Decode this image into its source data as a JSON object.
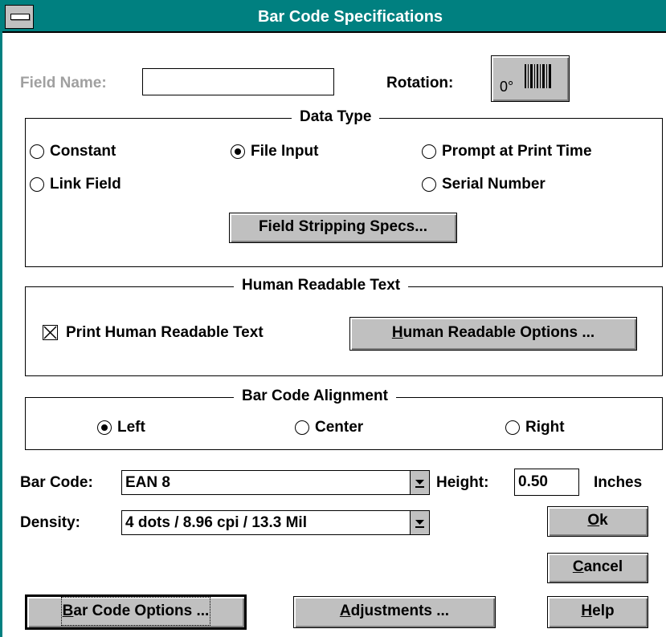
{
  "window": {
    "title": "Bar Code Specifications"
  },
  "field_name": {
    "label": "Field Name:",
    "value": ""
  },
  "rotation": {
    "label": "Rotation:",
    "button_text": "0°"
  },
  "data_type": {
    "legend": "Data Type",
    "options": [
      {
        "label": "Constant",
        "selected": false
      },
      {
        "label": "File Input",
        "selected": true
      },
      {
        "label": "Prompt at Print Time",
        "selected": false
      },
      {
        "label": "Link Field",
        "selected": false
      },
      {
        "label": "Serial Number",
        "selected": false
      }
    ],
    "stripping_button": "Field Stripping Specs..."
  },
  "human_readable": {
    "legend": "Human Readable Text",
    "checkbox_label": "Print Human Readable Text",
    "checked": true,
    "options_button_mnemonic": "H",
    "options_button_rest": "uman Readable Options ..."
  },
  "alignment": {
    "legend": "Bar Code Alignment",
    "options": [
      {
        "label": "Left",
        "selected": true
      },
      {
        "label": "Center",
        "selected": false
      },
      {
        "label": "Right",
        "selected": false
      }
    ]
  },
  "bar_code": {
    "label": "Bar Code:",
    "value": "EAN 8"
  },
  "height": {
    "label": "Height:",
    "value": "0.50",
    "unit": "Inches"
  },
  "density": {
    "label": "Density:",
    "value": "4 dots / 8.96 cpi / 13.3 Mil"
  },
  "buttons": {
    "ok_mnemonic": "O",
    "ok_rest": "k",
    "cancel_mnemonic": "C",
    "cancel_rest": "ancel",
    "help_mnemonic": "H",
    "help_rest": "elp",
    "barcode_options_mnemonic": "B",
    "barcode_options_rest": "ar Code Options ...",
    "adjustments_mnemonic": "A",
    "adjustments_rest": "djustments ..."
  },
  "colors": {
    "title_bar": "#008080",
    "face": "#c0c0c0",
    "disabled_text": "#a0a0a0"
  },
  "icons": {
    "system_menu": "system-menu-icon",
    "dropdown": "dropdown-arrow-icon",
    "barcode": "barcode-icon"
  }
}
